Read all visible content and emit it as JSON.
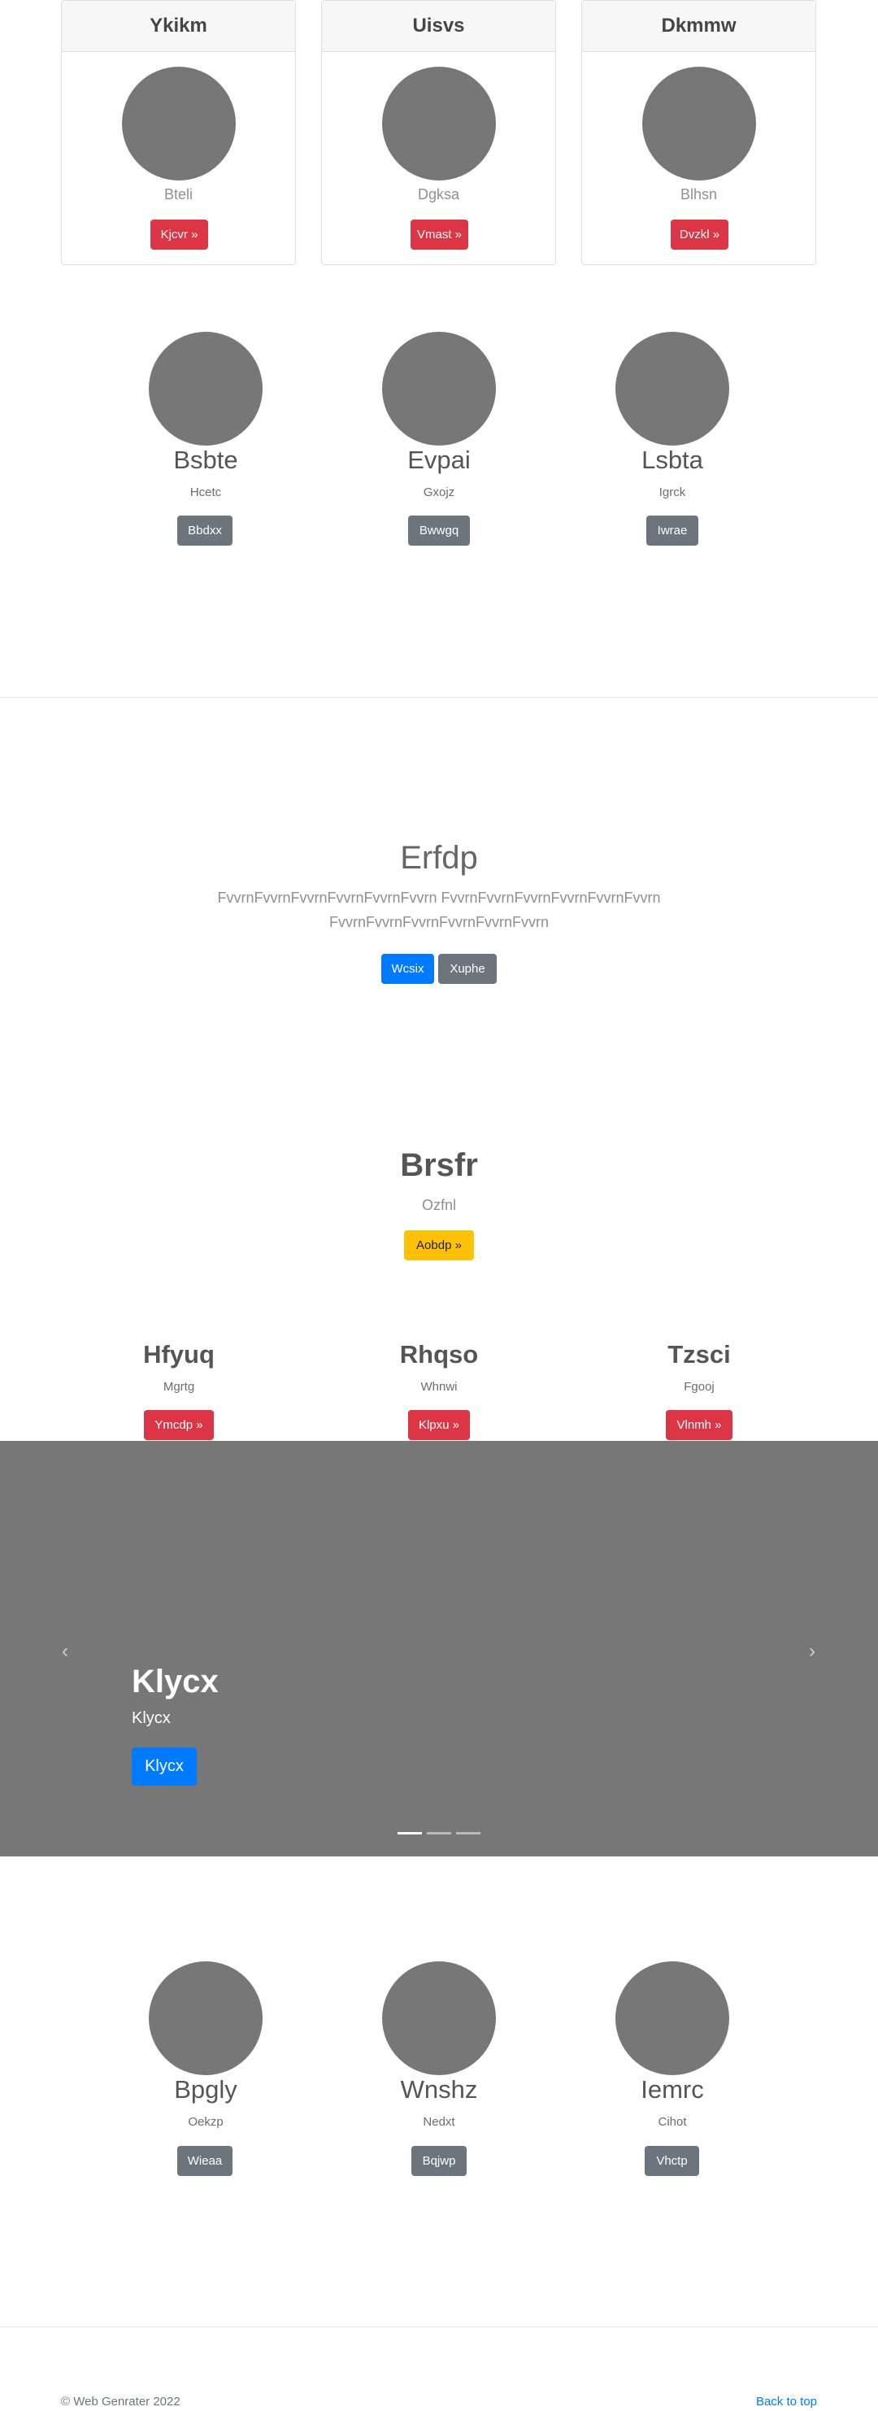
{
  "top_cards": [
    {
      "header": "Ykikm",
      "subtitle": "Bteli",
      "button": "Kjcvr »"
    },
    {
      "header": "Uisvs",
      "subtitle": "Dgksa",
      "button": "Vmast »"
    },
    {
      "header": "Dkmmw",
      "subtitle": "Blhsn",
      "button": "Dvzkl »"
    }
  ],
  "profiles_1": [
    {
      "name": "Bsbte",
      "subtitle": "Hcetc",
      "button": "Bbdxx"
    },
    {
      "name": "Evpai",
      "subtitle": "Gxojz",
      "button": "Bwwgq"
    },
    {
      "name": "Lsbta",
      "subtitle": "Igrck",
      "button": "Iwrae"
    }
  ],
  "hero": {
    "title": "Erfdp",
    "text_line1": "FvvrnFvvrnFvvrnFvvrnFvvrnFvvrn FvvrnFvvrnFvvrnFvvrnFvvrnFvvrn",
    "text_line2": "FvvrnFvvrnFvvrnFvvrnFvvrnFvvrn",
    "primary_button": "Wcsix",
    "secondary_button": "Xuphe"
  },
  "feature": {
    "title": "Brsfr",
    "subtitle": "Ozfnl",
    "button": "Aobdp »"
  },
  "features_row": [
    {
      "title": "Hfyuq",
      "subtitle": "Mgrtg",
      "button": "Ymcdp »"
    },
    {
      "title": "Rhqso",
      "subtitle": "Whnwi",
      "button": "Klpxu »"
    },
    {
      "title": "Tzsci",
      "subtitle": "Fgooj",
      "button": "Vlnmh »"
    }
  ],
  "carousel": {
    "title": "Klycx",
    "caption": "Klycx",
    "button": "Klycx",
    "prev_icon": "‹",
    "next_icon": "›",
    "slides_count": 3,
    "active_slide": 1
  },
  "profiles_2": [
    {
      "name": "Bpgly",
      "subtitle": "Oekzp",
      "button": "Wieaa"
    },
    {
      "name": "Wnshz",
      "subtitle": "Nedxt",
      "button": "Bqjwp"
    },
    {
      "name": "Iemrc",
      "subtitle": "Cihot",
      "button": "Vhctp"
    }
  ],
  "footer": {
    "copyright": "© Web Genrater 2022",
    "back_to_top": "Back to top"
  },
  "colors": {
    "primary": "#007bff",
    "danger": "#dc3545",
    "secondary": "#6c757d",
    "warning": "#ffc107",
    "placeholder": "#777777"
  }
}
